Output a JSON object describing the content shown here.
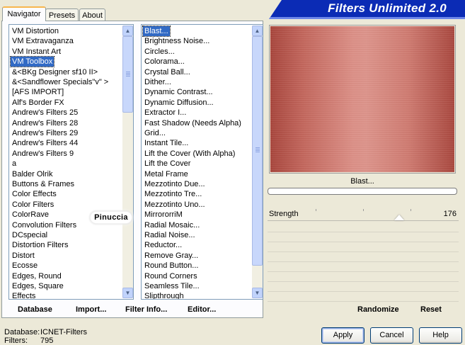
{
  "tabs": [
    "Navigator",
    "Presets",
    "About"
  ],
  "banner_title": "Filters Unlimited 2.0",
  "categories": {
    "selected_index": 3,
    "items": [
      "VM Distortion",
      "VM Extravaganza",
      "VM Instant Art",
      "VM Toolbox",
      "&<BKg Designer sf10 II>",
      "&<Sandflower Specials\"v\" >",
      "[AFS IMPORT]",
      "Alf's Border FX",
      "Andrew's Filters 25",
      "Andrew's Filters 28",
      "Andrew's Filters 29",
      "Andrew's Filters 44",
      "Andrew's Filters 9",
      "a",
      "Balder Olrik",
      "Buttons & Frames",
      "Color Effects",
      "Color Filters",
      "ColorRave",
      "Convolution Filters",
      "DCspecial",
      "Distortion Filters",
      "Distort",
      "Ecosse",
      "Edges, Round",
      "Edges, Square",
      "Effects"
    ]
  },
  "filters": {
    "selected_index": 0,
    "items": [
      "Blast...",
      "Brightness Noise...",
      "Circles...",
      "Colorama...",
      "Crystal Ball...",
      "Dither...",
      "Dynamic Contrast...",
      "Dynamic Diffusion...",
      "Extractor I...",
      "Fast Shadow (Needs Alpha)",
      "Grid...",
      "Instant Tile...",
      "Lift the Cover (With Alpha)",
      "Lift the Cover",
      "Metal Frame",
      "Mezzotinto Due...",
      "Mezzotinto Tre...",
      "Mezzotinto Uno...",
      "MirrororriM",
      "Radial Mosaic...",
      "Radial Noise...",
      "Reductor...",
      "Remove Gray...",
      "Round Button...",
      "Round Corners",
      "Seamless Tile...",
      "Slipthrough"
    ]
  },
  "panel_buttons": {
    "database": "Database",
    "import": "Import...",
    "filter_info": "Filter Info...",
    "editor": "Editor..."
  },
  "watermark": "Pinuccia",
  "preview_label": "Blast...",
  "parameter": {
    "name": "Strength",
    "value": "176",
    "level_fraction": 0.69
  },
  "right_buttons": {
    "randomize": "Randomize",
    "reset": "Reset"
  },
  "status": {
    "database_label": "Database:",
    "database_value": "ICNET-Filters",
    "filters_label": "Filters:",
    "filters_value": "795"
  },
  "dialog_buttons": {
    "apply": "Apply",
    "cancel": "Cancel",
    "help": "Help"
  },
  "colors": {
    "selection": "#316ac5",
    "banner": "#0b2bb5",
    "preview_mid": "#dd938a"
  }
}
